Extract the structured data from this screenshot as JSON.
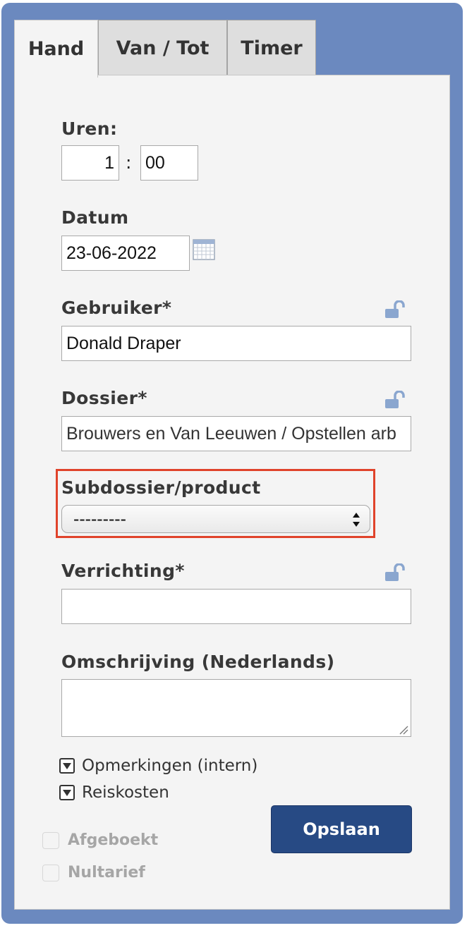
{
  "tabs": [
    {
      "label": "Hand",
      "active": true
    },
    {
      "label": "Van / Tot",
      "active": false
    },
    {
      "label": "Timer",
      "active": false
    }
  ],
  "uren": {
    "label": "Uren:",
    "hours": "1",
    "separator": ":",
    "minutes": "00"
  },
  "datum": {
    "label": "Datum",
    "value": "23-06-2022",
    "icon": "calendar-icon"
  },
  "gebruiker": {
    "label": "Gebruiker*",
    "value": "Donald Draper",
    "icon": "unlock-icon"
  },
  "dossier": {
    "label": "Dossier*",
    "value": "Brouwers en Van Leeuwen / Opstellen arb",
    "icon": "unlock-icon"
  },
  "subdossier": {
    "label": "Subdossier/product",
    "selected": "---------",
    "highlight_color": "#e0432b"
  },
  "verrichting": {
    "label": "Verrichting*",
    "value": "",
    "icon": "unlock-icon"
  },
  "omschrijving": {
    "label": "Omschrijving (Nederlands)",
    "value": ""
  },
  "toggles": [
    {
      "label": "Opmerkingen (intern)"
    },
    {
      "label": "Reiskosten"
    }
  ],
  "save_button": {
    "label": "Opslaan",
    "color": "#274a84"
  },
  "checkboxes": [
    {
      "label": "Afgeboekt",
      "checked": false
    },
    {
      "label": "Nultarief",
      "checked": false
    }
  ],
  "colors": {
    "frame": "#6b89bf",
    "panel": "#f4f4f4",
    "lock": "#8aa6cf"
  }
}
